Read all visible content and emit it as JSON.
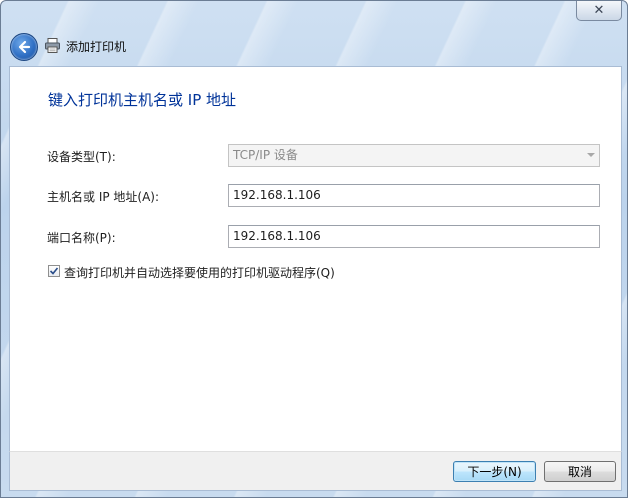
{
  "window": {
    "title": "添加打印机",
    "close_glyph": "✕"
  },
  "page": {
    "heading": "键入打印机主机名或 IP 地址"
  },
  "form": {
    "device_type_label": "设备类型(T):",
    "device_type_value": "TCP/IP 设备",
    "hostname_label": "主机名或 IP 地址(A):",
    "hostname_value": "192.168.1.106",
    "port_label": "端口名称(P):",
    "port_value": "192.168.1.106",
    "query_driver_label": "查询打印机并自动选择要使用的打印机驱动程序(Q)",
    "query_driver_checked": true
  },
  "footer": {
    "next_label": "下一步(N)",
    "cancel_label": "取消"
  },
  "icons": {
    "back": "back-arrow-icon",
    "printer": "printer-icon",
    "close": "close-icon",
    "dropdown": "chevron-down-icon",
    "check": "checkmark-icon"
  },
  "colors": {
    "heading": "#003399",
    "window_frame": "#bcd3ec",
    "default_button_border": "#3c7fb1"
  }
}
